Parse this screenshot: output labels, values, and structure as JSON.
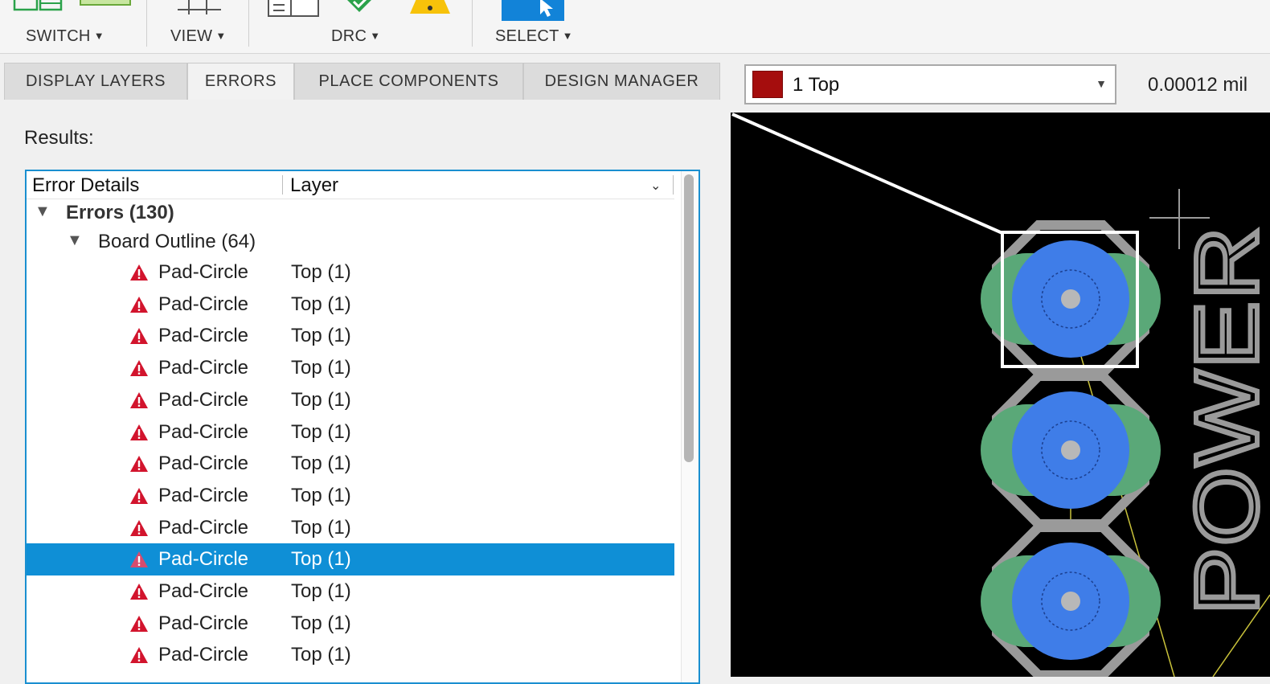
{
  "toolbar": {
    "groups": [
      {
        "label": "SWITCH"
      },
      {
        "label": "VIEW"
      },
      {
        "label": "DRC"
      },
      {
        "label": "SELECT"
      }
    ]
  },
  "tabs": [
    {
      "label": "DISPLAY LAYERS",
      "active": false
    },
    {
      "label": "ERRORS",
      "active": true
    },
    {
      "label": "PLACE COMPONENTS",
      "active": false
    },
    {
      "label": "DESIGN MANAGER",
      "active": false
    }
  ],
  "layer_select": {
    "value": "1 Top",
    "color": "#a50d0d"
  },
  "coordinate_readout": "0.00012 mil",
  "results": {
    "label": "Results:",
    "columns": [
      "Error Details",
      "Layer"
    ],
    "errors_group": "Errors (130)",
    "category": "Board Outline (64)",
    "rows": [
      {
        "name": "Pad-Circle",
        "layer": "Top (1)"
      },
      {
        "name": "Pad-Circle",
        "layer": "Top (1)"
      },
      {
        "name": "Pad-Circle",
        "layer": "Top (1)"
      },
      {
        "name": "Pad-Circle",
        "layer": "Top (1)"
      },
      {
        "name": "Pad-Circle",
        "layer": "Top (1)"
      },
      {
        "name": "Pad-Circle",
        "layer": "Top (1)"
      },
      {
        "name": "Pad-Circle",
        "layer": "Top (1)"
      },
      {
        "name": "Pad-Circle",
        "layer": "Top (1)"
      },
      {
        "name": "Pad-Circle",
        "layer": "Top (1)"
      },
      {
        "name": "Pad-Circle",
        "layer": "Top (1)",
        "selected": true
      },
      {
        "name": "Pad-Circle",
        "layer": "Top (1)"
      },
      {
        "name": "Pad-Circle",
        "layer": "Top (1)"
      },
      {
        "name": "Pad-Circle",
        "layer": "Top (1)"
      }
    ]
  },
  "board_view": {
    "silkscreen_text": "POWER",
    "colors": {
      "background": "#000000",
      "pad": "#3f7de8",
      "copper": "#5aa878",
      "outline": "#9a9a9a",
      "highlight": "#ffffff",
      "airwire": "#c9c23a"
    }
  }
}
